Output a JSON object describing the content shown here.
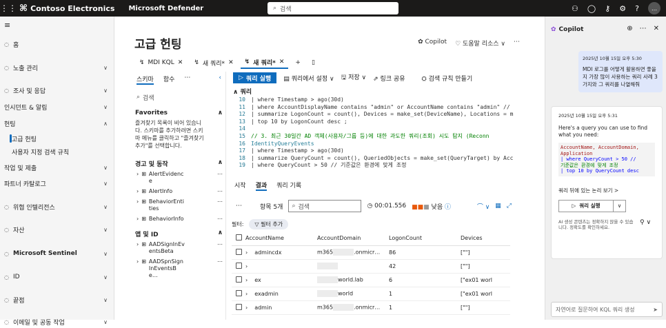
{
  "topbar": {
    "waffle_icon": "waffle-icon",
    "brand": "Contoso Electronics",
    "product": "Microsoft Defender",
    "search_placeholder": "검색",
    "avatar": "…"
  },
  "nav": {
    "items": [
      {
        "label": "홈",
        "icon": "home-icon"
      },
      {
        "label": "노출 관리",
        "icon": "exposure-icon",
        "chev": "∨"
      },
      {
        "label": "조사 및 응답",
        "icon": "shield-icon",
        "chev": "∨"
      },
      {
        "label": "인시던트 & 알림",
        "icon": "",
        "chev": "∨"
      },
      {
        "label": "헌팅",
        "icon": "",
        "chev": "∧"
      },
      {
        "label": "고급 헌팅",
        "icon": "",
        "sub": true,
        "active": true
      },
      {
        "label": "사용자 지정 검색 규칙",
        "icon": "",
        "sub": true
      },
      {
        "label": "작업 및 제출",
        "icon": "",
        "chev": "∨"
      },
      {
        "label": "파트너 카탈로그",
        "icon": "",
        "chev": "∨"
      },
      {
        "label": "위협 인텔리전스",
        "icon": "threat-icon",
        "chev": "∨"
      },
      {
        "label": "자산",
        "icon": "asset-icon",
        "chev": "∨"
      },
      {
        "label": "Microsoft Sentinel",
        "icon": "sentinel-icon",
        "chev": "∨",
        "bold": true
      },
      {
        "label": "ID",
        "icon": "id-icon",
        "chev": "∨"
      },
      {
        "label": "끝점",
        "icon": "endpoint-icon",
        "chev": "∨"
      },
      {
        "label": "이메일 및 공동 작업",
        "icon": "mail-icon",
        "chev": "∨"
      }
    ]
  },
  "page": {
    "title": "고급 헌팅",
    "copilot": "Copilot",
    "help": "도움말 리소스",
    "more": "⋯"
  },
  "tabs": [
    {
      "label": "MDI KQL"
    },
    {
      "label": "새 쿼리*"
    },
    {
      "label": "새 쿼리*",
      "active": true
    }
  ],
  "schema": {
    "tab1": "스키마",
    "tab2": "함수",
    "tab3": "⋯",
    "search": "검색",
    "favorites_title": "Favorites",
    "favorites_text": "즐겨찾기 목록이 비어 있습니다. 스키마를 추가하려면 스키마 메뉴를 클릭하고 \"즐겨찾기 추가\"를 선택합니다.",
    "alerts_title": "경고 및 동작",
    "alerts": [
      "AlertEvidence",
      "AlertInfo",
      "BehaviorEntities",
      "BehaviorInfo"
    ],
    "apps_title": "앱 및 ID",
    "apps": [
      "AADSignInEventsBeta",
      "AADSpnSignInEventsBe…"
    ]
  },
  "toolbar": {
    "run": "쿼리 실행",
    "set_from_query": "쿼리에서 설정",
    "save": "저장",
    "share": "링크 공유",
    "create_rule": "검색 규칙 만들기"
  },
  "query_label": "쿼리",
  "code": [
    {
      "n": "10",
      "t": "| where Timestamp > ago(30d)"
    },
    {
      "n": "11",
      "t": "| where AccountDisplayName contains \"admin\" or AccountName contains \"admin\" //"
    },
    {
      "n": "12",
      "t": "| summarize LogonCount = count(), Devices = make_set(DeviceName), Locations = m"
    },
    {
      "n": "13",
      "t": "| top 10 by LogonCount desc ;"
    },
    {
      "n": "14",
      "t": ""
    },
    {
      "n": "15",
      "t": "// 3. 최근 30일간 AD 객체(사용자/그룹 등)에 대한 과도한 쿼리(조회) 시도 탐지 (Reconn"
    },
    {
      "n": "16",
      "t": "IdentityQueryEvents"
    },
    {
      "n": "17",
      "t": "| where Timestamp > ago(30d)"
    },
    {
      "n": "18",
      "t": "| summarize QueryCount = count(), QueriedObjects = make_set(QueryTarget) by Acc"
    },
    {
      "n": "19",
      "t": "| where QueryCount > 50 // 기준값은 환경에 맞게 조정"
    }
  ],
  "results": {
    "tabs": [
      "시작",
      "결과",
      "쿼리 기록"
    ],
    "items": "항목 5개",
    "search": "검색",
    "time": "00:01.556",
    "level": "낮음",
    "filter_label": "필터:",
    "add_filter": "필터 추가",
    "columns": [
      "AccountName",
      "AccountDomain",
      "LogonCount",
      "Devices"
    ],
    "rows": [
      {
        "name": "admincdx",
        "domain_pre": "m365",
        "domain_post": ".onmicr…",
        "count": "86",
        "devices": "[\"\"]"
      },
      {
        "name": "",
        "domain_pre": "",
        "domain_post": "",
        "count": "42",
        "devices": "[\"\"]"
      },
      {
        "name": "ex",
        "domain_pre": "",
        "domain_post": "world.lab",
        "count": "6",
        "devices": "[\"ex01      worl"
      },
      {
        "name": "exadmin",
        "domain_pre": "",
        "domain_post": "world",
        "count": "1",
        "devices": "[\"ex01      worl"
      },
      {
        "name": "admin",
        "domain_pre": "m365",
        "domain_post": ".onmicr…",
        "count": "1",
        "devices": "[\"\"]"
      }
    ]
  },
  "copilot": {
    "title": "Copilot",
    "user_time": "2025년 10월 15일 오후 5:30",
    "user_msg": "MDI 로그를 어떻게 활용하면 좋을지 가장 많이 사용하는 쿼리 사례 3가지와 그 쿼리를 나열해줘",
    "bot_time": "2025년 10월 15일 오후 5:31",
    "bot_msg": "Here's a query you can use to find what you need:",
    "code": [
      "AccountName, AccountDomain,",
      "Application",
      "| where QueryCount > 50 //",
      "기준값은 환경에 맞게 조정",
      "| top 10 by QueryCount desc"
    ],
    "see_more": "쿼리 뒤에 있는 논리 보기 >",
    "run": "쿼리 실행",
    "disclaimer": "AI 생성 콘텐츠는 정확하지 않을 수 있습니다. 정확도를 확인하세요.",
    "input": "자연어로 질문하여 KQL 쿼리 생성"
  }
}
